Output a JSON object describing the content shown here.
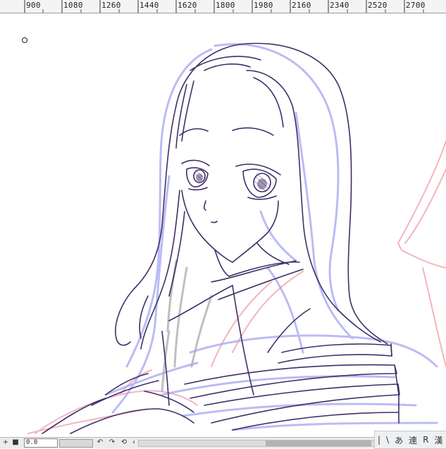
{
  "ruler": {
    "labels": [
      "900",
      "1080",
      "1260",
      "1440",
      "1620",
      "1800",
      "1980",
      "2160",
      "2340",
      "2520",
      "2700"
    ]
  },
  "statusbar": {
    "add_label": "+",
    "stop_label": "■",
    "zoom_value": "0.0",
    "undo_glyph": "↶",
    "redo_glyph": "↷",
    "reset_glyph": "⟲",
    "scroll_left_glyph": "‹"
  },
  "ime": {
    "items": [
      "|",
      "\\",
      "あ",
      "連",
      "R",
      "漢"
    ]
  },
  "icons": {
    "brush_cursor": "circle-cursor-icon",
    "undo": "rotate-left-icon",
    "redo": "rotate-right-icon",
    "reset": "reset-rotation-icon"
  },
  "colors": {
    "line_dark": "#3f2f68",
    "line_blue": "#9ea0f0",
    "line_pink": "#f2a7b6",
    "line_gray": "#b0b0b0"
  }
}
